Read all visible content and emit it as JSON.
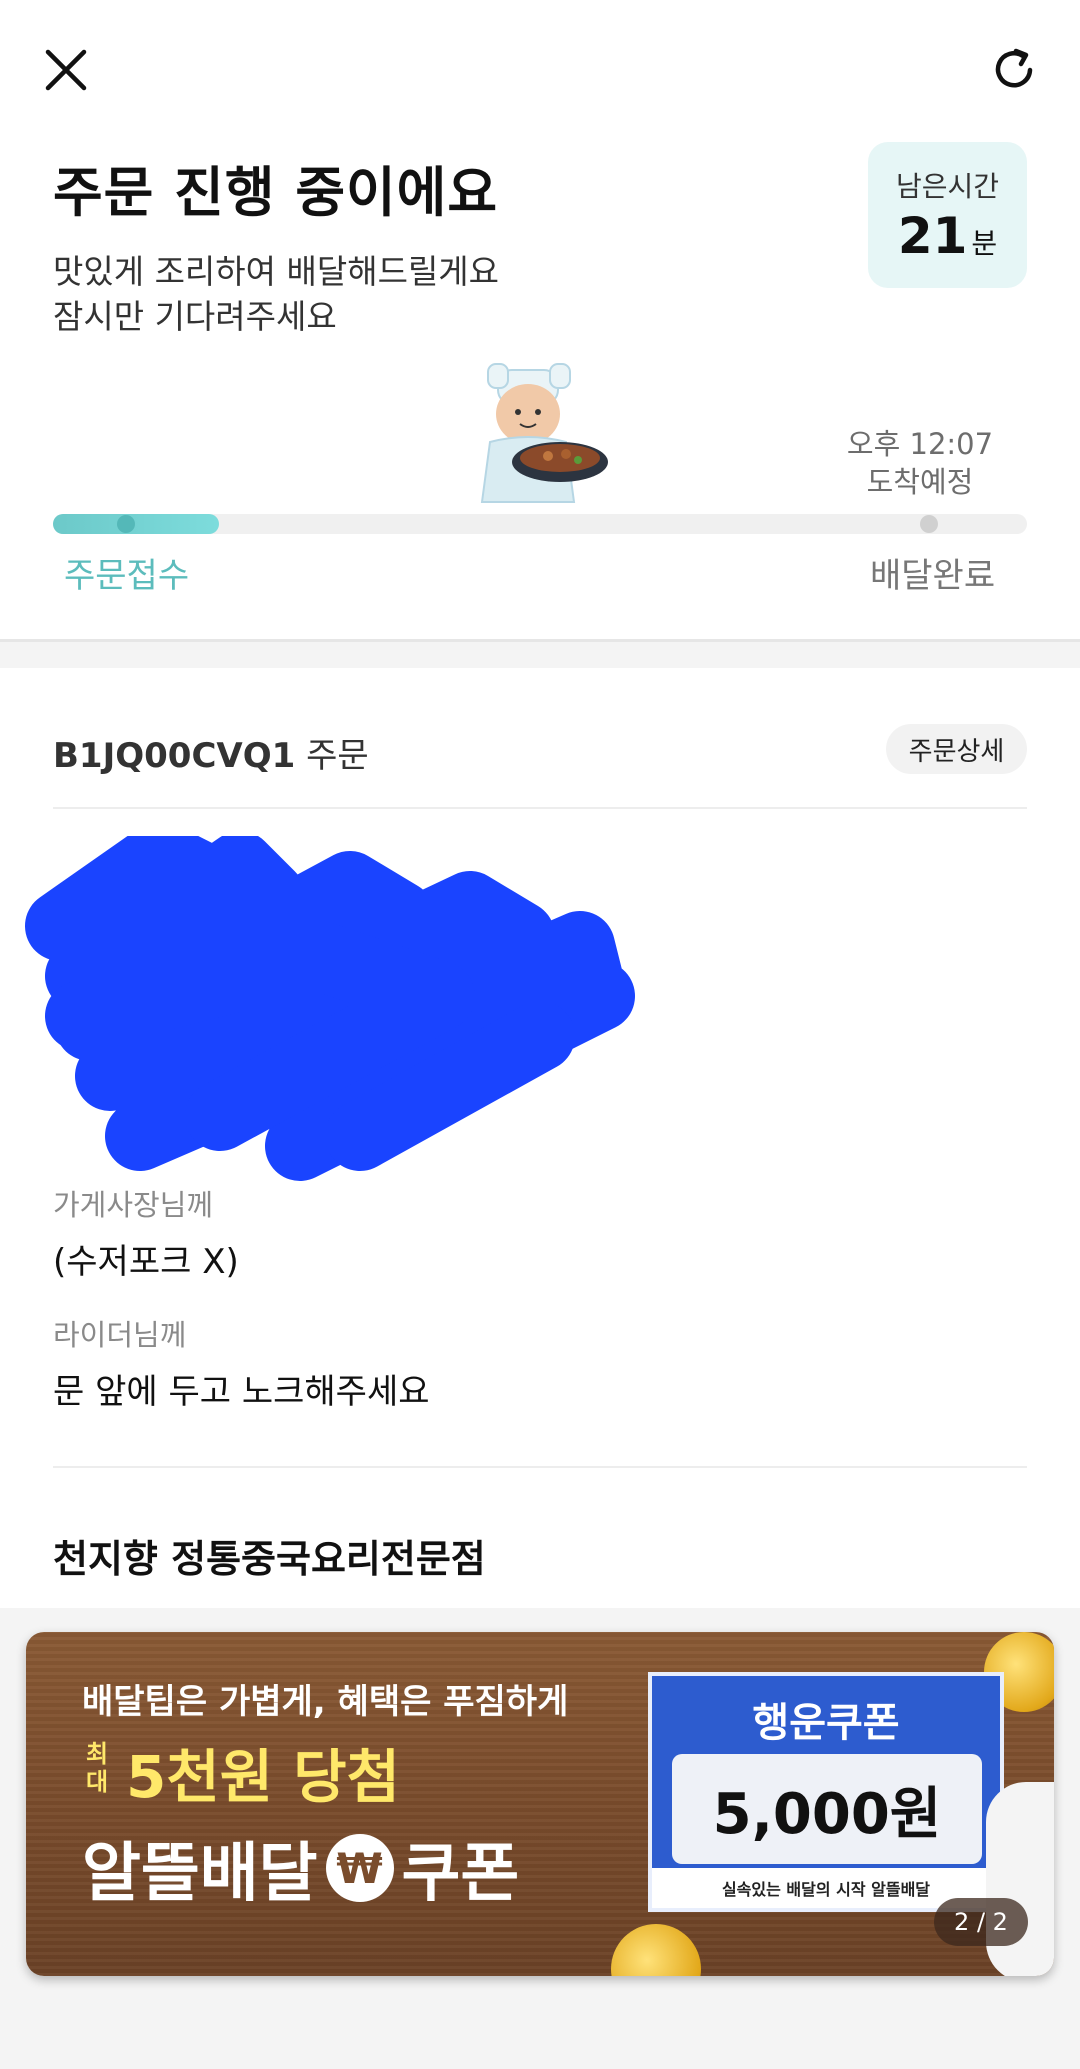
{
  "status": {
    "title": "주문 진행 중이에요",
    "subtitle_line1": "맛있게 조리하여 배달해드릴게요",
    "subtitle_line2": "잠시만 기다려주세요",
    "remaining_label": "남은시간",
    "remaining_value": "21",
    "remaining_unit": "분",
    "eta_time": "오후 12:07",
    "eta_label": "도착예정",
    "progress_fraction": 0.17,
    "step_start": "주문접수",
    "step_end": "배달완료"
  },
  "order": {
    "id": "B1JQ00CVQ1",
    "id_suffix": "주문",
    "detail_button": "주문상세",
    "owner_note_label": "가게사장님께",
    "owner_note": "(수저포크 X)",
    "rider_note_label": "라이더님께",
    "rider_note": "문 앞에 두고 노크해주세요",
    "store_name": "천지향 정통중국요리전문점"
  },
  "banner": {
    "line1": "배달팁은 가볍게, 혜택은 푸짐하게",
    "max_label": "최대",
    "line2": "5천원 당첨",
    "line3_a": "알뜰배달",
    "won_symbol": "₩",
    "line3_b": "쿠폰",
    "coupon_title": "행운쿠폰",
    "coupon_amount": "5,000원",
    "coupon_footer": "실속있는 배달의 시작 알뜰배달",
    "pager": "2 / 2"
  },
  "colors": {
    "accent_teal": "#5cbcbc",
    "redaction_blue": "#1a44ff",
    "coupon_blue": "#2d5ccf",
    "banner_brown": "#7a4c2c"
  }
}
